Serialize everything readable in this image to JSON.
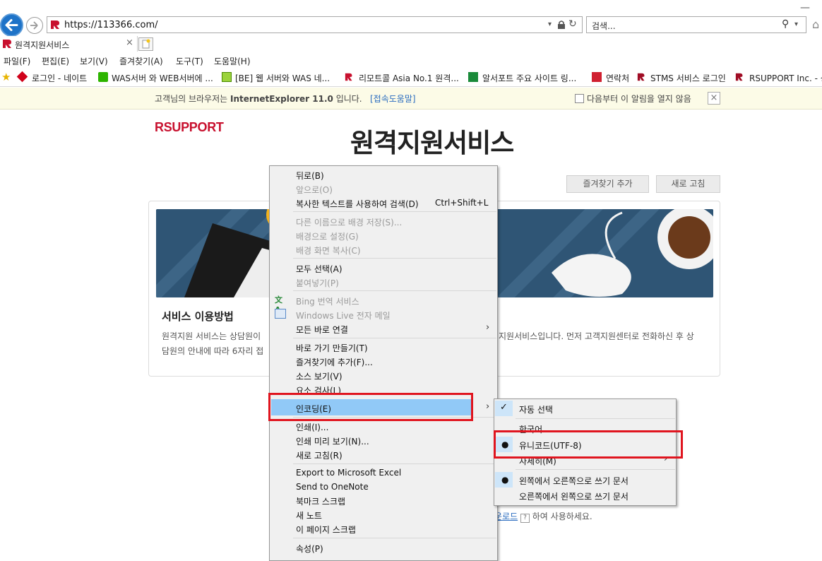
{
  "browser": {
    "url": "https://113366.com/",
    "search_placeholder": "검색...",
    "tab_title": "원격지원서비스",
    "menu": [
      "파일(F)",
      "편집(E)",
      "보기(V)",
      "즐겨찾기(A)",
      "도구(T)",
      "도움말(H)"
    ],
    "favorites": [
      "로그인 - 네이트",
      "WAS서버 와 WEB서버에 ...",
      "[BE] 웹 서버와 WAS  네...",
      "리모트콜  Asia No.1 원격...",
      "알서포트 주요 사이트 링...",
      "연락처",
      "STMS 서비스 로그인",
      "RSUPPORT Inc. - 상"
    ]
  },
  "infobar": {
    "message_prefix": "고객님의 브라우저는 ",
    "browser_name": "InternetExplorer 11.0",
    "message_suffix": " 입니다.",
    "help_link": "[접속도움말]",
    "dont_show": "다음부터 이 알림을 열지 않음"
  },
  "page": {
    "logo": "RSUPPORT",
    "title": "원격지원서비스",
    "add_favorite": "즐겨찾기 추가",
    "refresh": "새로 고침",
    "service_title": "서비스 이용방법",
    "service_text_1a": "원격지원 서비스는 상담원이",
    "service_text_1b": "지원서비스입니다. 먼저 고객지원센터로 전화하신 후 상",
    "service_text_2": "담원의 안내에 따라 6자리 접",
    "download_link": "운로드",
    "download_suffix": " 하여 사용하세요."
  },
  "context_menu": {
    "items": [
      {
        "label": "뒤로(B)",
        "enabled": true
      },
      {
        "label": "앞으로(O)",
        "enabled": false
      },
      {
        "label": "복사한 텍스트를 사용하여 검색(D)",
        "shortcut": "Ctrl+Shift+L",
        "enabled": true
      },
      {
        "label": "다른 이름으로 배경 저장(S)...",
        "enabled": false
      },
      {
        "label": "배경으로 설정(G)",
        "enabled": false
      },
      {
        "label": "배경 화면 복사(C)",
        "enabled": false
      },
      {
        "label": "모두 선택(A)",
        "enabled": true
      },
      {
        "label": "붙여넣기(P)",
        "enabled": false
      },
      {
        "label": "Bing 번역 서비스",
        "enabled": false
      },
      {
        "label": "Windows Live 전자 메일",
        "enabled": false
      },
      {
        "label": "모든 바로 연결",
        "enabled": true
      },
      {
        "label": "바로 가기 만들기(T)",
        "enabled": true
      },
      {
        "label": "즐겨찾기에 추가(F)...",
        "enabled": true
      },
      {
        "label": "소스 보기(V)",
        "enabled": true
      },
      {
        "label": "요소 검사(L)",
        "enabled": true
      },
      {
        "label": "인코딩(E)",
        "enabled": true
      },
      {
        "label": "인쇄(I)...",
        "enabled": true
      },
      {
        "label": "인쇄 미리 보기(N)...",
        "enabled": true
      },
      {
        "label": "새로 고침(R)",
        "enabled": true
      },
      {
        "label": "Export to Microsoft Excel",
        "enabled": true
      },
      {
        "label": "Send to OneNote",
        "enabled": true
      },
      {
        "label": "북마크 스크랩",
        "enabled": true
      },
      {
        "label": "새 노트",
        "enabled": true
      },
      {
        "label": "이 페이지 스크랩",
        "enabled": true
      },
      {
        "label": "속성(P)",
        "enabled": true
      }
    ]
  },
  "encoding_submenu": {
    "items": [
      {
        "label": "자동 선택",
        "checked": true
      },
      {
        "label": "한국어"
      },
      {
        "label": "유니코드(UTF-8)",
        "selected": true
      },
      {
        "label": "자세히(M)"
      },
      {
        "label": "왼쪽에서 오른쪽으로 쓰기 문서",
        "selected": true
      },
      {
        "label": "오른쪽에서 왼쪽으로 쓰기 문서"
      }
    ]
  },
  "colors": {
    "accent": "#1e73c8",
    "brand_red": "#c8102e",
    "highlight": "#91c9f7",
    "annotation_red": "#e0151f"
  }
}
